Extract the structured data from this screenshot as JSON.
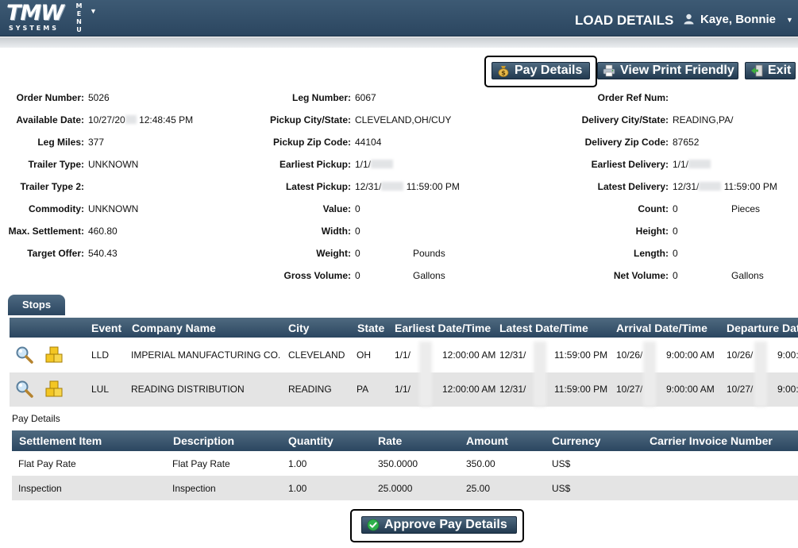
{
  "header": {
    "logo_main": "TMW",
    "logo_sub": "SYSTEMS",
    "menu_label": "MENU",
    "page_title": "LOAD DETAILS",
    "user_name": "Kaye, Bonnie"
  },
  "toolbar": {
    "pay_details": "Pay Details",
    "view_print": "View Print Friendly",
    "exit": "Exit"
  },
  "details": {
    "col1": [
      {
        "label": "Order Number:",
        "value": "5026"
      },
      {
        "label": "Available Date:",
        "value": "10/27/20",
        "value2": "12:48:45 PM"
      },
      {
        "label": "Leg Miles:",
        "value": "377"
      },
      {
        "label": "Trailer Type:",
        "value": "UNKNOWN"
      },
      {
        "label": "Trailer Type 2:",
        "value": ""
      },
      {
        "label": "Commodity:",
        "value": "UNKNOWN"
      },
      {
        "label": "Max. Settlement:",
        "value": "460.80"
      },
      {
        "label": "Target Offer:",
        "value": "540.43"
      }
    ],
    "col2": [
      {
        "label": "Leg Number:",
        "value": "6067"
      },
      {
        "label": "Pickup City/State:",
        "value": "CLEVELAND,OH/CUY"
      },
      {
        "label": "Pickup Zip Code:",
        "value": "44104"
      },
      {
        "label": "Earliest Pickup:",
        "value": "1/1/"
      },
      {
        "label": "Latest Pickup:",
        "value": "12/31/",
        "value2": "11:59:00 PM"
      },
      {
        "label": "Value:",
        "value": "0"
      },
      {
        "label": "Width:",
        "value": "0"
      },
      {
        "label": "Weight:",
        "value": "0",
        "unit": "Pounds"
      },
      {
        "label": "Gross Volume:",
        "value": "0",
        "unit": "Gallons"
      }
    ],
    "col3": [
      {
        "label": "Order Ref Num:",
        "value": ""
      },
      {
        "label": "Delivery City/State:",
        "value": "READING,PA/"
      },
      {
        "label": "Delivery Zip Code:",
        "value": "87652"
      },
      {
        "label": "Earliest Delivery:",
        "value": "1/1/"
      },
      {
        "label": "Latest Delivery:",
        "value": "12/31/",
        "value2": "11:59:00 PM"
      },
      {
        "label": "Count:",
        "value": "0",
        "unit": "Pieces"
      },
      {
        "label": "Height:",
        "value": "0"
      },
      {
        "label": "Length:",
        "value": "0"
      },
      {
        "label": "Net Volume:",
        "value": "0",
        "unit": "Gallons"
      }
    ]
  },
  "stops": {
    "tab": "Stops",
    "headers": [
      "Event",
      "Company Name",
      "City",
      "State",
      "Earliest Date/Time",
      "Latest Date/Time",
      "Arrival Date/Time",
      "Departure Date"
    ],
    "rows": [
      {
        "event": "LLD",
        "company": "IMPERIAL MANUFACTURING CO.",
        "city": "CLEVELAND",
        "state": "OH",
        "earliest_a": "1/1/",
        "earliest_b": "12:00:00 AM",
        "latest_a": "12/31/",
        "latest_b": "11:59:00 PM",
        "arrival_a": "10/26/",
        "arrival_b": "9:00:00 AM",
        "departure_a": "10/26/",
        "departure_b": "9:00:"
      },
      {
        "event": "LUL",
        "company": "READING DISTRIBUTION",
        "city": "READING",
        "state": "PA",
        "earliest_a": "1/1/",
        "earliest_b": "12:00:00 AM",
        "latest_a": "12/31/",
        "latest_b": "11:59:00 PM",
        "arrival_a": "10/27/",
        "arrival_b": "9:00:00 AM",
        "departure_a": "10/27/",
        "departure_b": "9:00:"
      }
    ]
  },
  "pay": {
    "title": "Pay Details",
    "headers": [
      "Settlement Item",
      "Description",
      "Quantity",
      "Rate",
      "Amount",
      "Currency",
      "Carrier Invoice Number"
    ],
    "rows": [
      {
        "item": "Flat Pay Rate",
        "description": "Flat Pay Rate",
        "quantity": "1.00",
        "rate": "350.0000",
        "amount": "350.00",
        "currency": "US$",
        "invoice": ""
      },
      {
        "item": "Inspection",
        "description": "Inspection",
        "quantity": "1.00",
        "rate": "25.0000",
        "amount": "25.00",
        "currency": "US$",
        "invoice": ""
      }
    ],
    "approve_label": "Approve Pay Details"
  },
  "colors": {
    "header_bg": "#2b4660",
    "table_header_bg": "#3d5870",
    "row_alt_bg": "#e4e4e4",
    "approve_icon": "#2db04b"
  },
  "icons": [
    "user-icon",
    "money-bag-icon",
    "printer-icon",
    "exit-door-icon",
    "magnifier-icon",
    "boxes-icon",
    "checkmark-icon"
  ]
}
